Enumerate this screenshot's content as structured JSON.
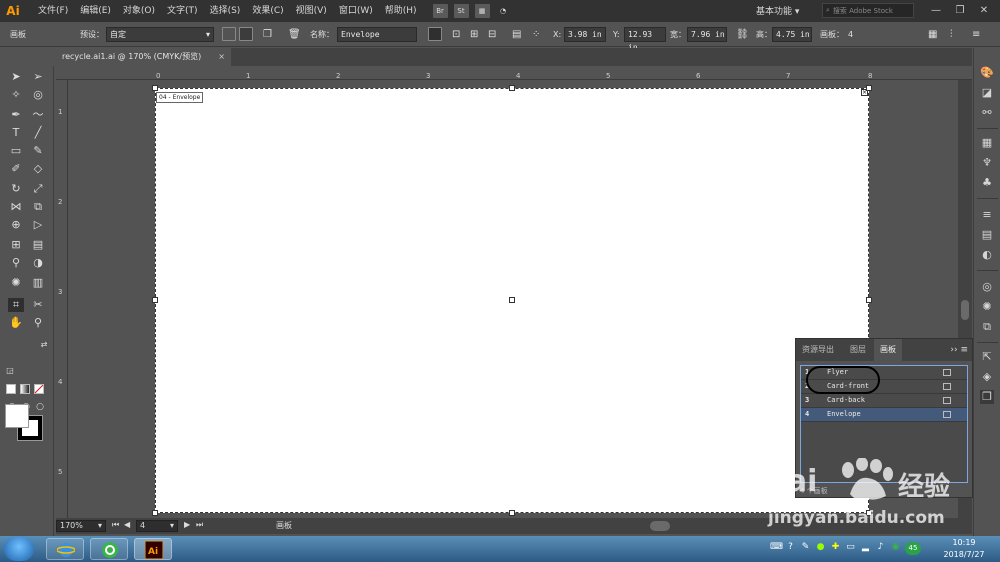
{
  "app": {
    "logo": "Ai",
    "workspace": "基本功能 ▾",
    "stock_search_placeholder": "搜索 Adobe Stock"
  },
  "menu": [
    "文件(F)",
    "编辑(E)",
    "对象(O)",
    "文字(T)",
    "选择(S)",
    "效果(C)",
    "视图(V)",
    "窗口(W)",
    "帮助(H)"
  ],
  "app_buttons": [
    "Br",
    "St"
  ],
  "window_controls": [
    "—",
    "❐",
    "✕"
  ],
  "control_bar": {
    "mode_label": "画板",
    "preset_label": "预设：",
    "preset_value": "自定",
    "name_label": "名称：",
    "name_value": "Envelope",
    "x_label": "X:",
    "x_value": "3.98 in",
    "y_label": "Y:",
    "y_value": "12.93 in",
    "w_label": "宽：",
    "w_value": "7.96 in",
    "h_label": "高：",
    "h_value": "4.75 in",
    "artboards_label": "画板：",
    "artboards_value": "4"
  },
  "document_tab": {
    "title": "recycle.ai1.ai @ 170% (CMYK/预览)",
    "close": "×"
  },
  "ruler": {
    "h_ticks": [
      "0",
      "1",
      "2",
      "3",
      "4",
      "5",
      "6",
      "7",
      "8"
    ],
    "v_ticks": [
      "1",
      "2",
      "3",
      "4",
      "5"
    ]
  },
  "artboard": {
    "label": "04 - Envelope",
    "close": "×"
  },
  "status_bar": {
    "zoom": "170%",
    "page": "4",
    "label": "画板"
  },
  "artboards_panel": {
    "tabs": [
      "资源导出",
      "图层",
      "画板"
    ],
    "active_tab": 2,
    "menu": "›› ≡",
    "rows": [
      {
        "num": "1",
        "name": "Flyer",
        "selected": false
      },
      {
        "num": "2",
        "name": "Card-front",
        "selected": false
      },
      {
        "num": "3",
        "name": "Card-back",
        "selected": false
      },
      {
        "num": "4",
        "name": "Envelope",
        "selected": true
      }
    ],
    "footer": "4 个画板"
  },
  "watermark": {
    "brand_left": "Bai",
    "brand_right": "经验",
    "url": "jingyan.baidu.com"
  },
  "taskbar": {
    "clock_time": "10:19",
    "clock_date": "2018/7/27",
    "badge": "45"
  },
  "colors": {
    "accent": "#ff9a00",
    "selection": "#445a7a",
    "panel_border": "#7ea7e0"
  }
}
